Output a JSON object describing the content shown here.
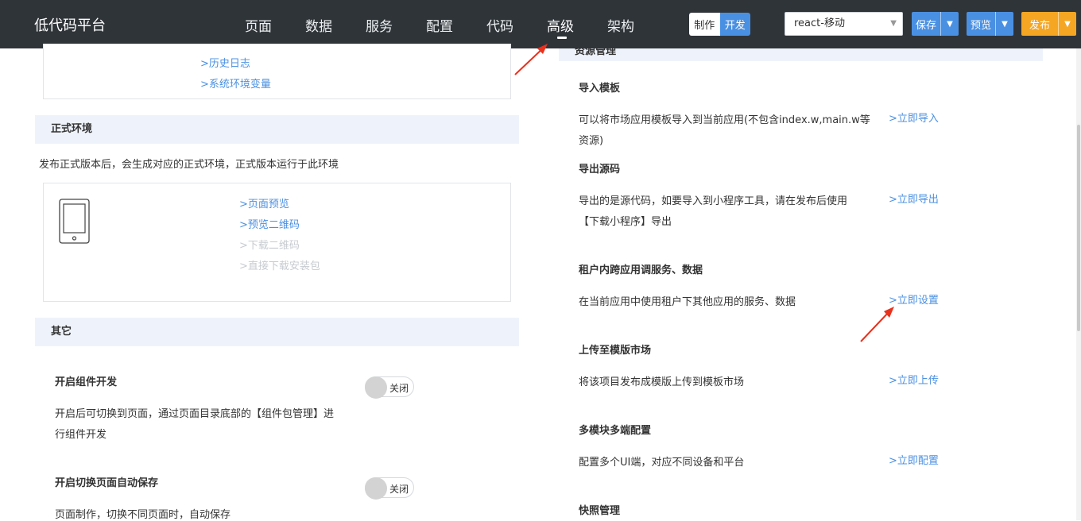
{
  "header": {
    "app_title": "低代码平台",
    "nav": [
      "页面",
      "数据",
      "服务",
      "配置",
      "代码",
      "高级",
      "架构"
    ],
    "active_nav": "高级",
    "mode_make": "制作",
    "mode_dev": "开发",
    "env_select_value": "react-移动",
    "save_label": "保存",
    "preview_label": "预览",
    "publish_label": "发布"
  },
  "left": {
    "test_env_links": [
      ">历史日志",
      ">系统环境变量"
    ],
    "prod_section_title": "正式环境",
    "prod_desc": "发布正式版本后，会生成对应的正式环境，正式版本运行于此环境",
    "prod_links": [
      ">页面预览",
      ">预览二维码"
    ],
    "prod_disabled_links": [
      ">下载二维码",
      ">直接下载安装包"
    ],
    "other_section_title": "其它",
    "option1_title": "开启组件开发",
    "option1_toggle": "关闭",
    "option1_desc_line1": "开启后可切换到页面，通过页面目录底部的【组件包管理】进",
    "option1_desc_line2": "行组件开发",
    "option2_title": "开启切换页面自动保存",
    "option2_toggle": "关闭",
    "option2_desc": "页面制作，切换不同页面时，自动保存"
  },
  "right": {
    "section_title": "资源管理",
    "items": [
      {
        "title": "导入模板",
        "desc_line1": "可以将市场应用模板导入到当前应用(不包含index.w,main.w等",
        "desc_line2": "资源)",
        "action": ">立即导入"
      },
      {
        "title": "导出源码",
        "desc_line1": "导出的是源代码，如要导入到小程序工具，请在发布后使用",
        "desc_line2": "【下载小程序】导出",
        "action": ">立即导出"
      },
      {
        "title": "租户内跨应用调服务、数据",
        "desc_line1": "在当前应用中使用租户下其他应用的服务、数据",
        "desc_line2": "",
        "action": ">立即设置"
      },
      {
        "title": "上传至模版市场",
        "desc_line1": "将该项目发布成模版上传到模板市场",
        "desc_line2": "",
        "action": ">立即上传"
      },
      {
        "title": "多模块多端配置",
        "desc_line1": "配置多个UI端，对应不同设备和平台",
        "desc_line2": "",
        "action": ">立即配置"
      },
      {
        "title": "快照管理",
        "desc_line1": "",
        "desc_line2": "",
        "action": ""
      }
    ]
  },
  "colors": {
    "topbar": "#2f3439",
    "accent_blue": "#4a90e2",
    "publish_orange": "#f5a623",
    "section_bg": "#eef3fb",
    "annotation_red": "#e8321e"
  }
}
